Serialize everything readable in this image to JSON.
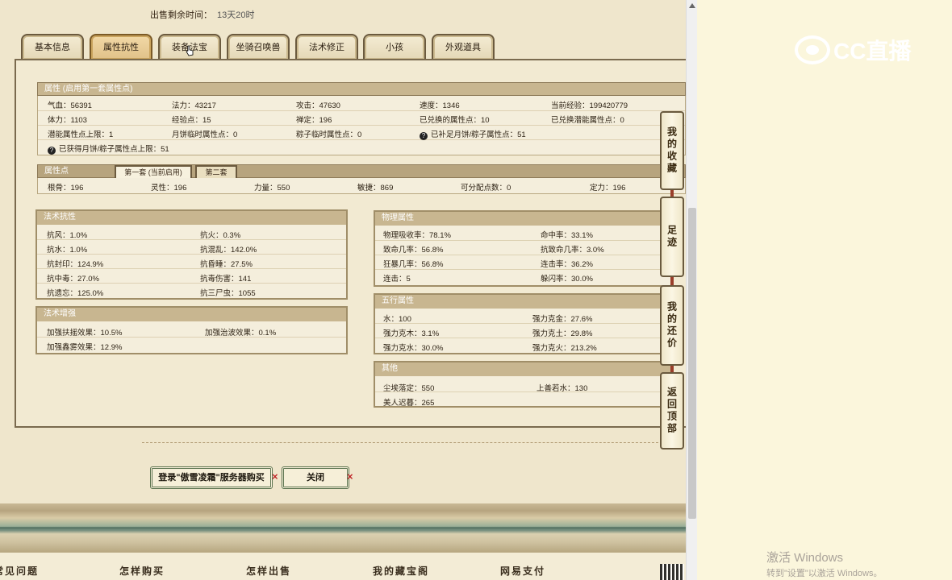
{
  "sale_time": {
    "label": "出售剩余时间：",
    "value": "13天20时"
  },
  "tabs": [
    "基本信息",
    "属性抗性",
    "装备法宝",
    "坐骑召唤兽",
    "法术修正",
    "小孩",
    "外观道具"
  ],
  "attr_section": {
    "title": "属性 (启用第一套属性点)",
    "rows": [
      [
        "气血：56391",
        "法力：43217",
        "攻击：47630",
        "速度：1346",
        "当前经验：199420779"
      ],
      [
        "体力：1103",
        "经验点：15",
        "禅定：196",
        "已兑换的属性点：10",
        "已兑换潜能属性点：0"
      ],
      [
        "潜能属性点上限：1",
        "月饼临时属性点：0",
        "粽子临时属性点：0",
        "已补足月饼/粽子属性点：51",
        ""
      ]
    ],
    "extra": "已获得月饼/粽子属性点上限：51"
  },
  "points_section": {
    "title": "属性点",
    "subtabs": [
      "第一套 (当前启用)",
      "第二套"
    ],
    "values": [
      "根骨：196",
      "灵性：196",
      "力量：550",
      "敏捷：869",
      "可分配点数：0",
      "定力：196"
    ]
  },
  "magic_resist": {
    "title": "法术抗性",
    "rows": [
      [
        "抗风：1.0%",
        "抗火：0.3%"
      ],
      [
        "抗水：1.0%",
        "抗混乱：142.0%"
      ],
      [
        "抗封印：124.9%",
        "抗昏睡：27.5%"
      ],
      [
        "抗中毒：27.0%",
        "抗毒伤害：141"
      ],
      [
        "抗遗忘：125.0%",
        "抗三尸虫：1055"
      ]
    ]
  },
  "magic_enhance": {
    "title": "法术增强",
    "rows": [
      [
        "加强扶摇效果：10.5%",
        "加强治波效果：0.1%"
      ],
      [
        "加强鑫雾效果：12.9%",
        ""
      ]
    ]
  },
  "physical": {
    "title": "物理属性",
    "rows": [
      [
        "物理吸收率：78.1%",
        "命中率：33.1%"
      ],
      [
        "致命几率：56.8%",
        "抗致命几率：3.0%"
      ],
      [
        "狂暴几率：56.8%",
        "连击率：36.2%"
      ],
      [
        "连击：5",
        "躲闪率：30.0%"
      ]
    ]
  },
  "five_elements": {
    "title": "五行属性",
    "rows": [
      [
        "水：100",
        "强力克金：27.6%"
      ],
      [
        "强力克木：3.1%",
        "强力克土：29.8%"
      ],
      [
        "强力克水：30.0%",
        "强力克火：213.2%"
      ]
    ]
  },
  "other": {
    "title": "其他",
    "rows": [
      [
        "尘埃落定：550",
        "上善若水：130"
      ],
      [
        "美人迟暮：265",
        ""
      ]
    ]
  },
  "side_nav": [
    "我的收藏",
    "足迹",
    "我的还价",
    "返回顶部"
  ],
  "buttons": {
    "login_buy": "登录\"傲雪凌霜\"服务器购买",
    "close": "关闭",
    "x_mark": "×"
  },
  "footer_links": [
    "常见问题",
    "怎样购买",
    "怎样出售",
    "我的藏宝阁",
    "网易支付"
  ],
  "logo_text": "CC直播",
  "watermark": {
    "line1": "激活 Windows",
    "line2": "转到\"设置\"以激活 Windows。"
  }
}
